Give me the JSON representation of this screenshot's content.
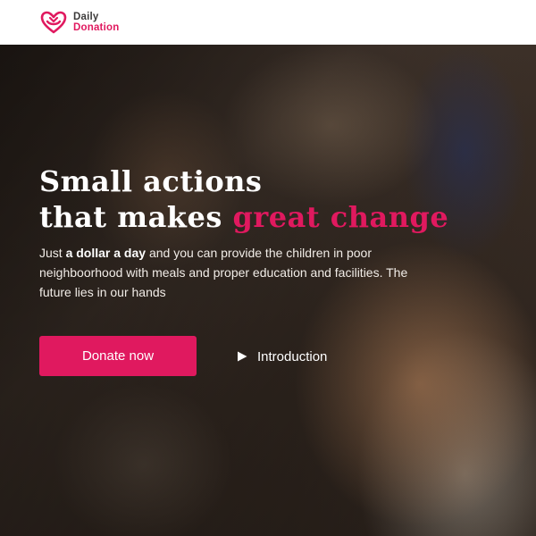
{
  "header": {
    "logo_line1": "Daily",
    "logo_line2": "Donation",
    "logo_icon": "heart-hands-logo-icon"
  },
  "hero": {
    "headline_line1": "Small actions",
    "headline_line2_prefix": "that makes ",
    "headline_line2_accent": "great change",
    "sub_part1": "Just ",
    "sub_bold": "a dollar a day",
    "sub_part2": " and you can provide the children in poor neighboorhood with meals and proper education and facilities. The future lies in our hands",
    "donate_label": "Donate now",
    "intro_label": "Introduction",
    "intro_icon": "play-icon"
  },
  "colors": {
    "accent": "#e0195f",
    "header_bg": "#ffffff",
    "text_light": "#ffffff"
  }
}
